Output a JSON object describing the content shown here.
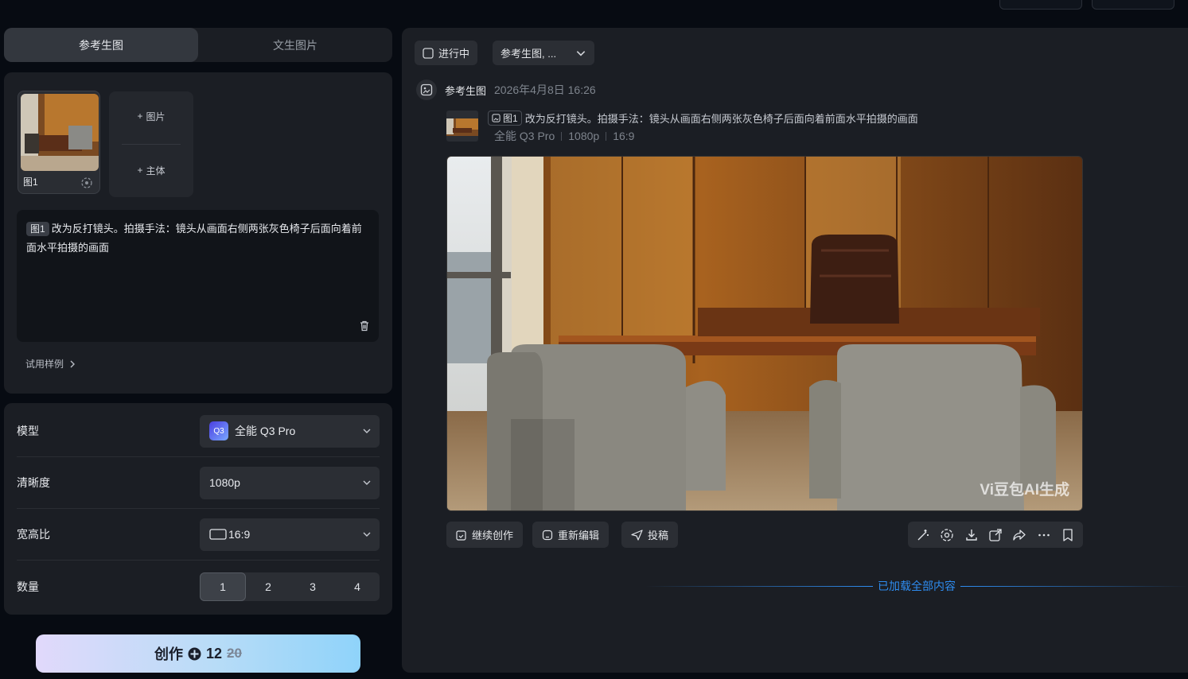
{
  "tabs": [
    {
      "label": "参考生图"
    },
    {
      "label": "文生图片"
    }
  ],
  "reference": {
    "thumb_label": "图1",
    "add_image": "图片",
    "add_subject": "主体"
  },
  "prompt": {
    "tag": "图1",
    "text": "改为反打镜头。拍摄手法：镜头从画面右侧两张灰色椅子后面向着前面水平拍摄的画面"
  },
  "try_example": "试用样例",
  "settings": {
    "model_label": "模型",
    "model_value": "全能 Q3 Pro",
    "model_badge": "Q3",
    "res_label": "清晰度",
    "res_value": "1080p",
    "ratio_label": "宽高比",
    "ratio_value": "16:9",
    "count_label": "数量",
    "count_options": [
      "1",
      "2",
      "3",
      "4"
    ],
    "count_selected": "1"
  },
  "create": {
    "label": "创作",
    "cost": "12",
    "original": "20"
  },
  "filters": {
    "in_progress": "进行中",
    "type": "参考生图, ..."
  },
  "record": {
    "title": "参考生图",
    "time": "2026年4月8日 16:26",
    "tag": "图1",
    "prompt": "改为反打镜头。拍摄手法：镜头从画面右侧两张灰色椅子后面向着前面水平拍摄的画面",
    "model": "全能 Q3 Pro",
    "resolution": "1080p",
    "ratio": "16:9",
    "watermark": "Vi豆包AI生成"
  },
  "actions": {
    "continue": "继续创作",
    "reedit": "重新编辑",
    "submit": "投稿"
  },
  "loaded": "已加载全部内容",
  "colors": {
    "accent": "#2e8cf0",
    "panel": "#1b1e24",
    "bg": "#070b12"
  }
}
